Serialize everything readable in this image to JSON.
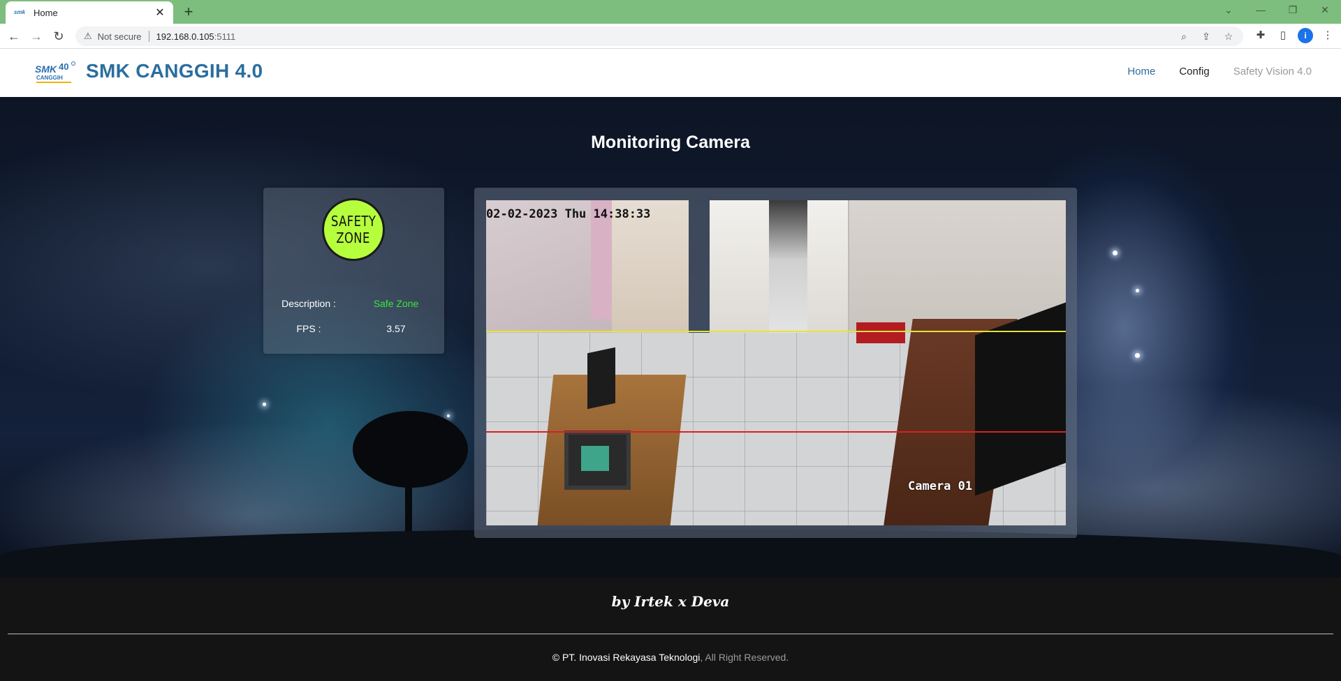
{
  "browser": {
    "tab_title": "Home",
    "tab_close": "✕",
    "new_tab": "+",
    "security_label": "Not secure",
    "url_host": "192.168.0.105",
    "url_port": ":5111",
    "profile_initial": "i"
  },
  "header": {
    "brand": "SMK CANGGIH 4.0",
    "logo_text": "SMK4.0",
    "nav": {
      "home": "Home",
      "config": "Config",
      "safety_vision": "Safety Vision 4.0"
    }
  },
  "main": {
    "title": "Monitoring Camera",
    "zone_badge": {
      "line1": "SAFETY",
      "line2": "ZONE",
      "color": "#b6ff3c"
    },
    "description_label": "Description :",
    "description_value": "Safe Zone",
    "description_color": "#39e639",
    "fps_label": "FPS :",
    "fps_value": "3.57",
    "camera": {
      "timestamp": "02-02-2023 Thu 14:38:33",
      "camera_name": "Camera 01",
      "line_colors": [
        "#e6e23a",
        "#d92020"
      ]
    }
  },
  "footer": {
    "signature": "by Irtek x Deva",
    "copyright_symbol": "©",
    "company": "PT. Inovasi Rekayasa Teknologi",
    "rights": ", All Right Reserved."
  }
}
